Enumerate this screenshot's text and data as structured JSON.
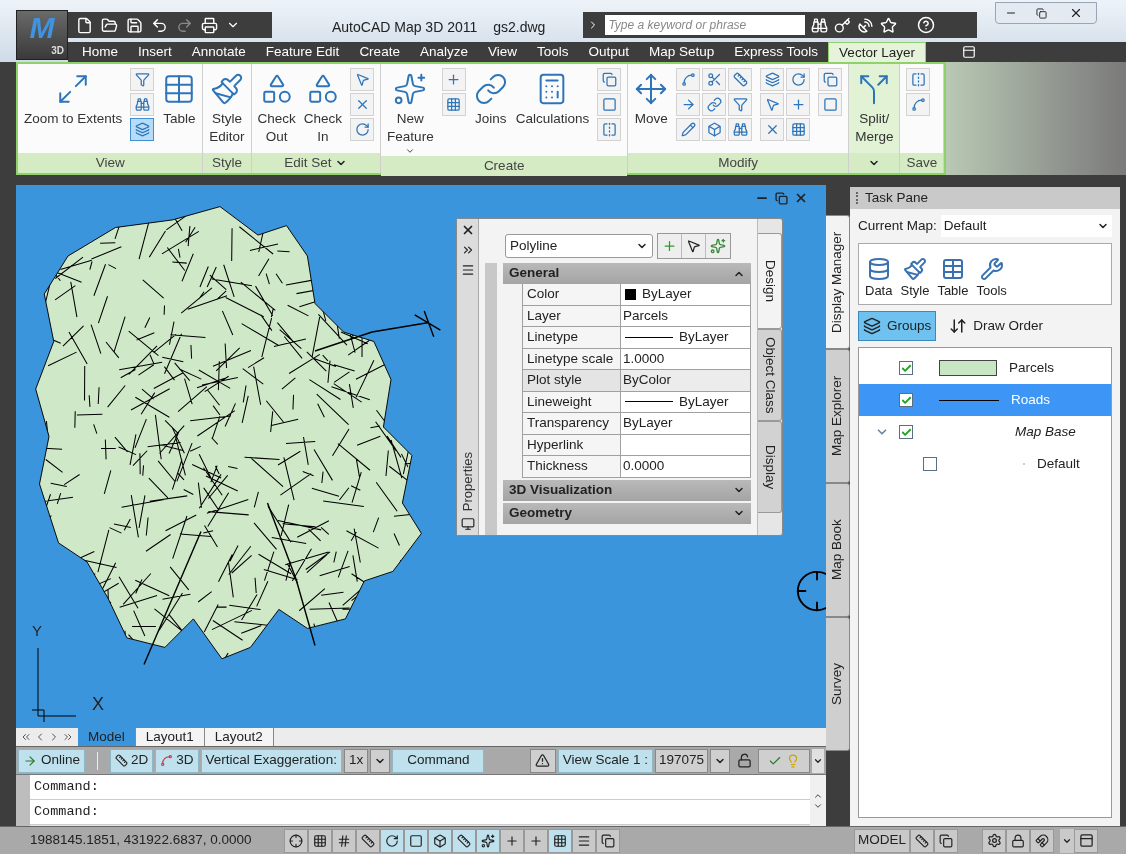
{
  "window": {
    "app_letter": "M",
    "app_badge": "3D",
    "title": "AutoCAD Map 3D 2011",
    "document": "gs2.dwg"
  },
  "search": {
    "placeholder": "Type a keyword or phrase"
  },
  "ribbon_tabs": [
    {
      "label": "Home",
      "selected": false
    },
    {
      "label": "Insert",
      "selected": false
    },
    {
      "label": "Annotate",
      "selected": false
    },
    {
      "label": "Feature Edit",
      "selected": false
    },
    {
      "label": "Create",
      "selected": false
    },
    {
      "label": "Analyze",
      "selected": false
    },
    {
      "label": "View",
      "selected": false
    },
    {
      "label": "Tools",
      "selected": false
    },
    {
      "label": "Output",
      "selected": false
    },
    {
      "label": "Map Setup",
      "selected": false
    },
    {
      "label": "Express Tools",
      "selected": false
    },
    {
      "label": "Vector Layer",
      "selected": true
    }
  ],
  "ribbon_panels": [
    {
      "title": "View",
      "dropdown": false,
      "highlighted": false,
      "items": [
        {
          "kind": "big",
          "label": "Zoom to Extents",
          "dropdown": false
        },
        {
          "kind": "tools",
          "tools": [
            {
              "selected": false
            },
            {
              "selected": false
            },
            {
              "selected": true
            }
          ]
        },
        {
          "kind": "big",
          "label": "Table",
          "dropdown": false
        }
      ]
    },
    {
      "title": "Style",
      "dropdown": false,
      "highlighted": false,
      "items": [
        {
          "kind": "big",
          "label": "Style\nEditor",
          "dropdown": false
        }
      ]
    },
    {
      "title": "Edit Set",
      "dropdown": true,
      "highlighted": false,
      "items": [
        {
          "kind": "big",
          "label": "Check\nOut",
          "dropdown": false
        },
        {
          "kind": "big",
          "label": "Check\nIn",
          "dropdown": false
        },
        {
          "kind": "tools",
          "tools": [
            {
              "selected": false
            },
            {
              "selected": false
            },
            {
              "selected": false
            }
          ]
        }
      ]
    },
    {
      "title": "Create",
      "dropdown": false,
      "highlighted": false,
      "items": [
        {
          "kind": "big",
          "label": "New\nFeature",
          "dropdown": true
        },
        {
          "kind": "tools",
          "tools": [
            {
              "selected": false
            },
            {
              "selected": false
            }
          ]
        },
        {
          "kind": "big",
          "label": "Joins",
          "dropdown": false
        },
        {
          "kind": "big",
          "label": "Calculations",
          "dropdown": false
        },
        {
          "kind": "tools",
          "tools": [
            {
              "selected": false
            },
            {
              "selected": false
            },
            {
              "selected": false
            }
          ]
        }
      ]
    },
    {
      "title": "Modify",
      "dropdown": false,
      "highlighted": false,
      "items": [
        {
          "kind": "big",
          "label": "Move",
          "dropdown": false
        },
        {
          "kind": "tools",
          "tools": [
            {
              "selected": false
            },
            {
              "selected": false
            },
            {
              "selected": false
            },
            {
              "selected": false
            },
            {
              "selected": false
            },
            {
              "selected": false
            },
            {
              "selected": false
            },
            {
              "selected": false
            },
            {
              "selected": false
            }
          ]
        },
        {
          "kind": "tools",
          "tools": [
            {
              "selected": false
            },
            {
              "selected": false
            },
            {
              "selected": false
            },
            {
              "selected": false
            },
            {
              "selected": false
            },
            {
              "selected": false
            }
          ]
        },
        {
          "kind": "tools",
          "tools": [
            {
              "selected": false
            },
            {
              "selected": false
            }
          ]
        }
      ]
    },
    {
      "dropdown": true,
      "highlighted": true,
      "items": [
        {
          "kind": "big",
          "label": "Split/\nMerge",
          "dropdown": false
        }
      ]
    },
    {
      "title": "Save",
      "dropdown": false,
      "highlighted": false,
      "items": [
        {
          "kind": "tools",
          "tools": [
            {
              "selected": false
            },
            {
              "selected": false
            }
          ]
        }
      ]
    }
  ],
  "canvas": {
    "ucs_x": "X",
    "ucs_y": "Y"
  },
  "properties_palette": {
    "title": "Properties",
    "object_type": "Polyline",
    "side_tabs": [
      {
        "label": "Design",
        "selected": true
      },
      {
        "label": "Object Class",
        "selected": false
      },
      {
        "label": "Display",
        "selected": false
      }
    ],
    "sections": [
      {
        "title": "General",
        "expanded": true,
        "rows": [
          {
            "name": "Color",
            "value": "ByLayer",
            "kind": "color",
            "disabled": false
          },
          {
            "name": "Layer",
            "value": "Parcels",
            "kind": "text",
            "disabled": false
          },
          {
            "name": "Linetype",
            "value": "ByLayer",
            "kind": "line",
            "disabled": false
          },
          {
            "name": "Linetype scale",
            "value": "1.0000",
            "kind": "text",
            "disabled": false
          },
          {
            "name": "Plot style",
            "value": "ByColor",
            "kind": "text",
            "disabled": true
          },
          {
            "name": "Lineweight",
            "value": "ByLayer",
            "kind": "line",
            "disabled": false
          },
          {
            "name": "Transparency",
            "value": "ByLayer",
            "kind": "text",
            "disabled": false
          },
          {
            "name": "Hyperlink",
            "kind": "text",
            "disabled": false
          },
          {
            "name": "Thickness",
            "value": "0.0000",
            "kind": "text",
            "disabled": false
          }
        ]
      },
      {
        "title": "3D Visualization",
        "expanded": false
      },
      {
        "title": "Geometry",
        "expanded": false
      }
    ]
  },
  "layout_tabs": [
    {
      "label": "Model",
      "selected": true
    },
    {
      "label": "Layout1",
      "selected": false
    },
    {
      "label": "Layout2",
      "selected": false
    }
  ],
  "status_toolbar": {
    "online": "Online",
    "view_2d": "2D",
    "view_3d": "3D",
    "exaggeration_label": "Vertical Exaggeration:",
    "exaggeration": "1x",
    "command": "Command",
    "view_scale_label": "View Scale 1 :",
    "view_scale": "197075"
  },
  "command_lines": [
    "Command:",
    "Command:"
  ],
  "status_bar": {
    "coordinates": "1988145.1851, 431922.6837, 0.0000",
    "toggles": [
      {
        "selected": false
      },
      {
        "selected": false
      },
      {
        "selected": false
      },
      {
        "selected": false
      },
      {
        "selected": true
      },
      {
        "selected": true
      },
      {
        "selected": true
      },
      {
        "selected": true
      },
      {
        "selected": true
      },
      {
        "selected": false
      },
      {
        "selected": false
      },
      {
        "selected": true
      },
      {
        "selected": false
      },
      {
        "selected": false
      }
    ],
    "space": "MODEL"
  },
  "task_pane": {
    "title": "Task Pane",
    "current_map_label": "Current Map:",
    "current_map": "Default",
    "side_tabs": [
      {
        "label": "Display Manager",
        "selected": true
      },
      {
        "label": "Map Explorer",
        "selected": false
      },
      {
        "label": "Map Book",
        "selected": false
      },
      {
        "label": "Survey",
        "selected": false
      }
    ],
    "tools": [
      "Data",
      "Style",
      "Table",
      "Tools"
    ],
    "view_buttons": [
      {
        "label": "Groups",
        "selected": true
      },
      {
        "label": "Draw Order",
        "selected": false
      }
    ],
    "layers": [
      {
        "name": "Parcels",
        "kind": "polygon",
        "checked": true,
        "selected": false
      },
      {
        "name": "Roads",
        "kind": "line",
        "checked": true,
        "selected": true
      },
      {
        "name": "Map Base",
        "kind": "group",
        "checked": true,
        "selected": false,
        "expanded": true,
        "children": [
          {
            "name": "Default",
            "kind": "point",
            "checked": false,
            "selected": false
          }
        ]
      }
    ]
  }
}
